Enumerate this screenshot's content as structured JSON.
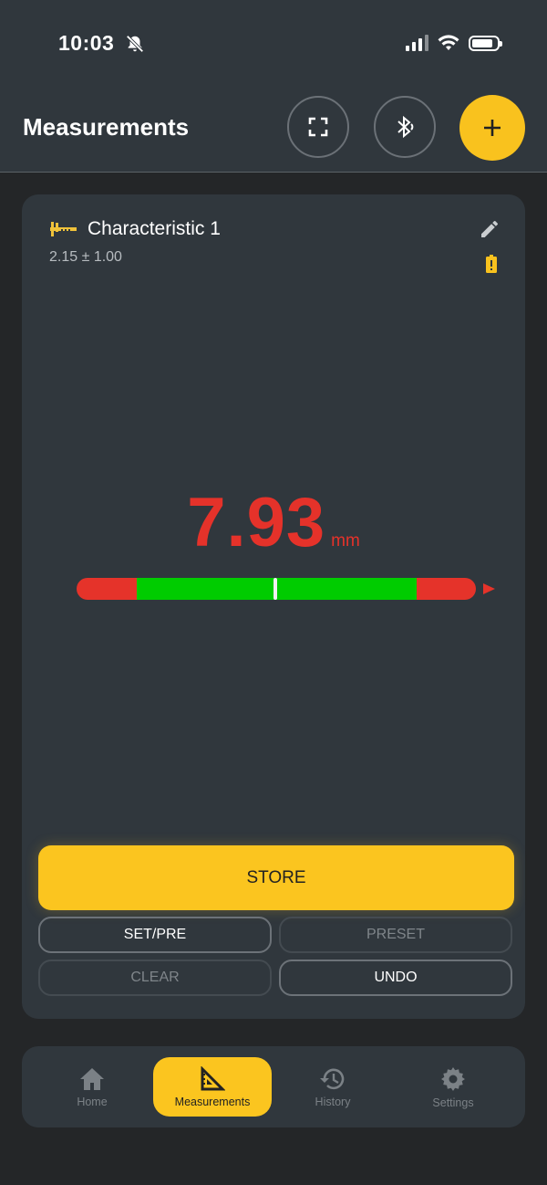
{
  "status_bar": {
    "time": "10:03"
  },
  "header": {
    "title": "Measurements"
  },
  "characteristic": {
    "title": "Characteristic 1",
    "tolerance": "2.15 ± 1.00"
  },
  "reading": {
    "value": "7.93",
    "unit": "mm",
    "gauge_marker_fraction": 0.5
  },
  "actions": {
    "store_label": "STORE",
    "setpre_label": "SET/PRE",
    "preset_label": "PRESET",
    "clear_label": "CLEAR",
    "undo_label": "UNDO"
  },
  "nav": {
    "items": [
      {
        "label": "Home",
        "icon": "home-icon",
        "active": false
      },
      {
        "label": "Measurements",
        "icon": "set-square-icon",
        "active": true
      },
      {
        "label": "History",
        "icon": "history-icon",
        "active": false
      },
      {
        "label": "Settings",
        "icon": "gear-icon",
        "active": false
      }
    ]
  },
  "colors": {
    "accent": "#fbc51f",
    "out_of_tolerance": "#e5322a",
    "in_tolerance": "#00cc00",
    "surface": "#30373d"
  }
}
